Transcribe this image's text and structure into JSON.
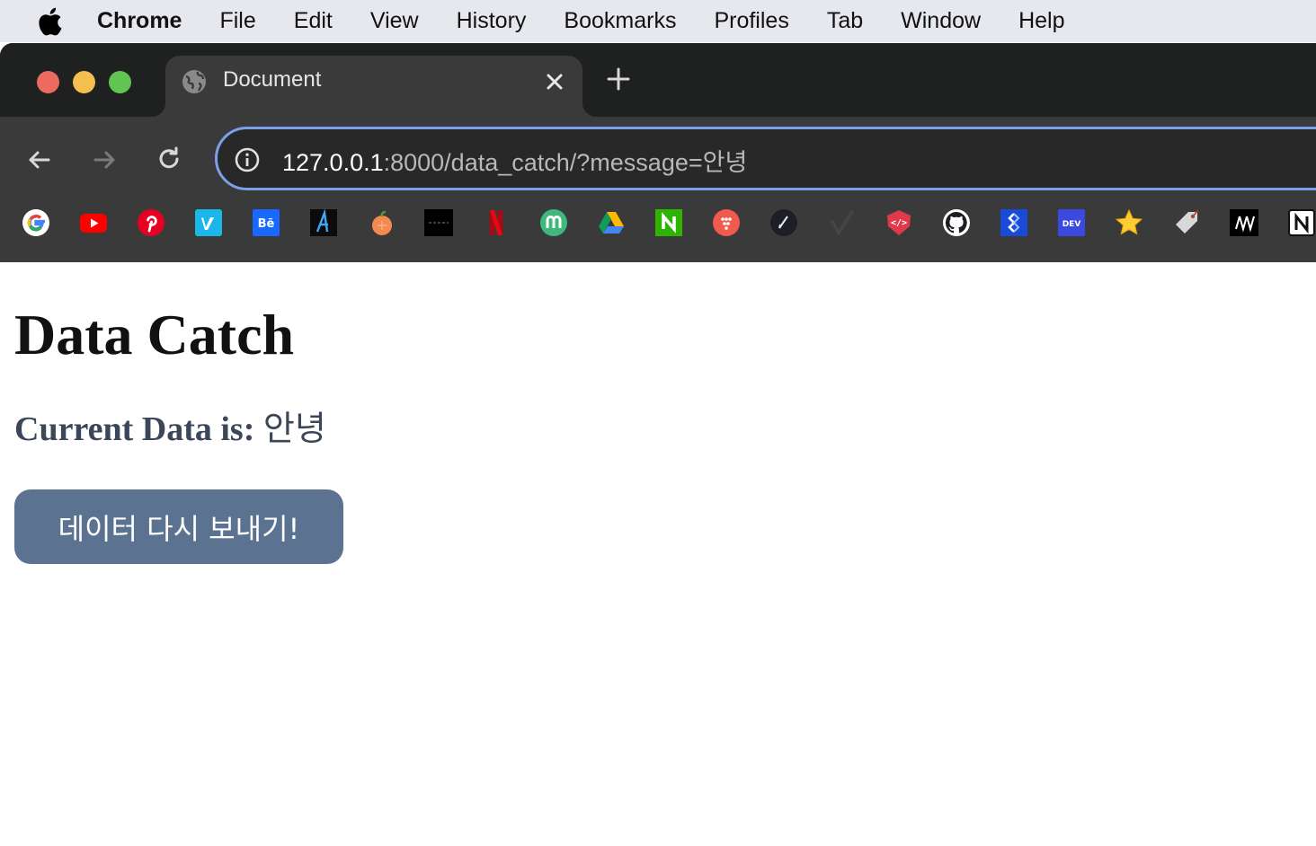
{
  "menubar": {
    "app_name": "Chrome",
    "items": [
      "File",
      "Edit",
      "View",
      "History",
      "Bookmarks",
      "Profiles",
      "Tab",
      "Window",
      "Help"
    ]
  },
  "browser": {
    "tab": {
      "title": "Document"
    },
    "address": {
      "host": "127.0.0.1",
      "path": ":8000/data_catch/?message=안녕"
    },
    "bookmarks": [
      "google-icon",
      "youtube-icon",
      "pinterest-icon",
      "vimeo-icon",
      "behance-icon",
      "app-a-icon",
      "fruit-icon",
      "dark-square-icon",
      "netflix-icon",
      "m-circle-icon",
      "google-drive-icon",
      "n-square-icon",
      "dots-circle-icon",
      "pen-circle-icon",
      "check-icon",
      "code-badge-icon",
      "github-icon",
      "jira-icon",
      "dev-icon",
      "star-icon",
      "tag-icon",
      "medium-icon",
      "notion-icon"
    ]
  },
  "page": {
    "title": "Data Catch",
    "current_label": "Current Data is:",
    "current_value": "안녕",
    "resend_button": "데이터 다시 보내기!"
  },
  "colors": {
    "accent_focus": "#7ca0e8",
    "button_bg": "#5b7290",
    "text_muted": "#3b4759"
  }
}
